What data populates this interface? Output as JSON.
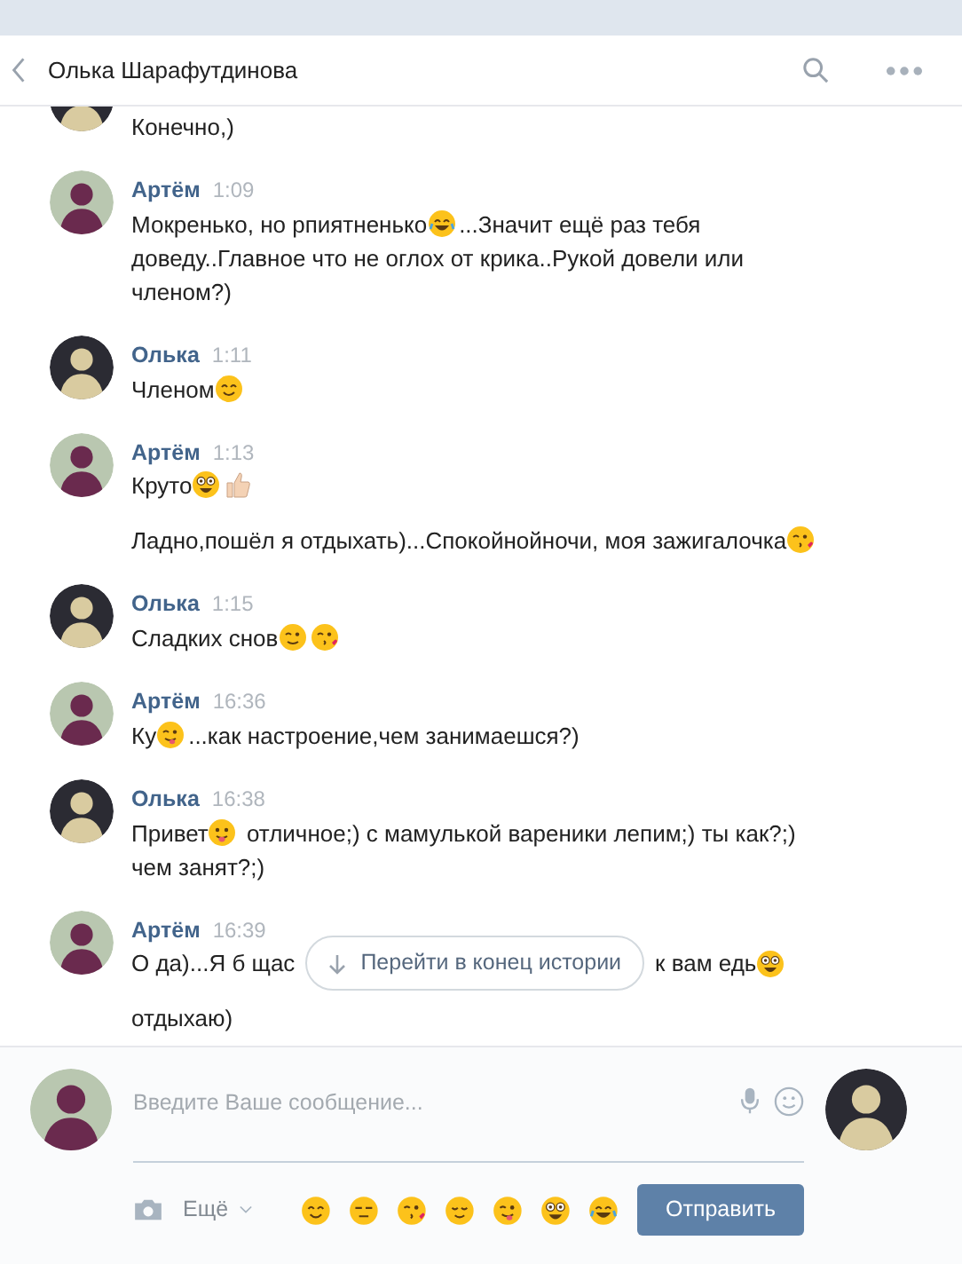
{
  "header": {
    "title": "Олька Шарафутдинова"
  },
  "messages": [
    {
      "avatar": {
        "kind": "female"
      },
      "paragraphs": [
        [
          {
            "kind": "text",
            "text": "Конечно,)"
          }
        ]
      ]
    },
    {
      "avatar": {
        "kind": "male"
      },
      "author": "Артём",
      "time": "1:09",
      "paragraphs": [
        [
          {
            "kind": "text",
            "text": "Мокренько, но рпиятненько"
          },
          {
            "kind": "laugh"
          },
          {
            "kind": "text",
            "text": "...Значит ещё раз тебя доведу..Главное что не оглох от крика..Рукой довели или членом?)"
          }
        ]
      ]
    },
    {
      "avatar": {
        "kind": "female"
      },
      "author": "Олька",
      "time": "1:11",
      "paragraphs": [
        [
          {
            "kind": "text",
            "text": "Членом"
          },
          {
            "kind": "smile"
          }
        ]
      ]
    },
    {
      "avatar": {
        "kind": "male"
      },
      "author": "Артём",
      "time": "1:13",
      "paragraphs": [
        [
          {
            "kind": "text",
            "text": "Круто"
          },
          {
            "kind": "wide"
          },
          {
            "kind": "thumbs"
          }
        ],
        [
          {
            "kind": "text",
            "text": "Ладно,пошёл я отдыхать)...Спокойнойночи, моя зажигалочка"
          },
          {
            "kind": "kiss"
          }
        ]
      ]
    },
    {
      "avatar": {
        "kind": "female"
      },
      "author": "Олька",
      "time": "1:15",
      "paragraphs": [
        [
          {
            "kind": "text",
            "text": "Сладких снов"
          },
          {
            "kind": "wink"
          },
          {
            "kind": "kiss"
          }
        ]
      ]
    },
    {
      "avatar": {
        "kind": "male"
      },
      "author": "Артём",
      "time": "16:36",
      "paragraphs": [
        [
          {
            "kind": "text",
            "text": "Ку"
          },
          {
            "kind": "winktongue"
          },
          {
            "kind": "text",
            "text": "...как настроение,чем занимаешся?)"
          }
        ]
      ]
    },
    {
      "avatar": {
        "kind": "female"
      },
      "author": "Олька",
      "time": "16:38",
      "paragraphs": [
        [
          {
            "kind": "text",
            "text": "Привет"
          },
          {
            "kind": "tongue"
          },
          {
            "kind": "text",
            "text": " отличное;) с мамулькой вареники лепим;) ты как?;) чем занят?;)"
          }
        ]
      ]
    },
    {
      "avatar": {
        "kind": "male"
      },
      "author": "Артём",
      "time": "16:39",
      "paragraphs": [
        [
          {
            "kind": "text",
            "text": "О да)...Я б щас"
          },
          {
            "kind": "button",
            "label": "Перейти в конец истории"
          },
          {
            "kind": "text",
            "text": "к вам едь"
          },
          {
            "kind": "wide"
          }
        ],
        [
          {
            "kind": "text",
            "text": "отдыхаю)"
          }
        ]
      ]
    }
  ],
  "composer": {
    "placeholder": "Введите Ваше сообщение...",
    "my_avatar": {
      "kind": "male"
    },
    "peer_avatar": {
      "kind": "female"
    },
    "more": "Ещё",
    "emojis": [
      {
        "kind": "smile"
      },
      {
        "kind": "unamused"
      },
      {
        "kind": "kiss"
      },
      {
        "kind": "relieved"
      },
      {
        "kind": "winktongue"
      },
      {
        "kind": "wide"
      },
      {
        "kind": "laugh"
      }
    ],
    "send": "Отправить"
  }
}
